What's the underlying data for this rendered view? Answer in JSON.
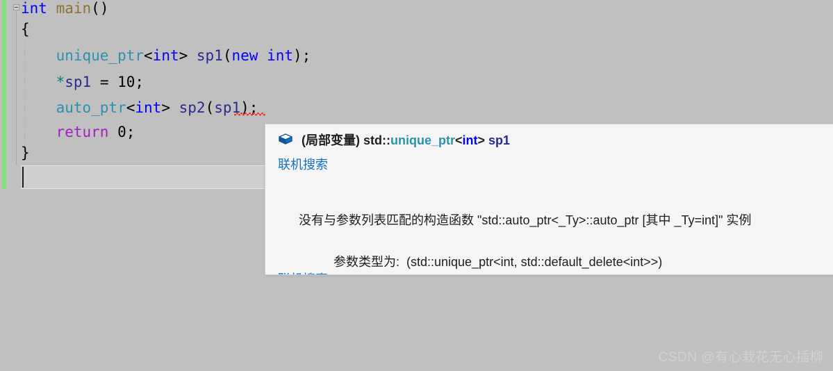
{
  "editor": {
    "lines": [
      {
        "id": "line1",
        "tokens": [
          {
            "text": "int",
            "kind": "kw"
          },
          {
            "text": " ",
            "kind": "plain"
          },
          {
            "text": "main",
            "kind": "fn"
          },
          {
            "text": "()",
            "kind": "plain"
          }
        ],
        "plain": "int main()"
      },
      {
        "id": "line2",
        "tokens": [
          {
            "text": "{",
            "kind": "plain"
          }
        ],
        "plain": "{"
      },
      {
        "id": "line3",
        "tokens": [
          {
            "text": "    ",
            "kind": "plain"
          },
          {
            "text": "unique_ptr",
            "kind": "type"
          },
          {
            "text": "<",
            "kind": "plain"
          },
          {
            "text": "int",
            "kind": "kw"
          },
          {
            "text": "> ",
            "kind": "plain"
          },
          {
            "text": "sp1",
            "kind": "ident"
          },
          {
            "text": "(",
            "kind": "plain"
          },
          {
            "text": "new",
            "kind": "kw"
          },
          {
            "text": " ",
            "kind": "plain"
          },
          {
            "text": "int",
            "kind": "kw"
          },
          {
            "text": ");",
            "kind": "plain"
          }
        ],
        "plain": "    unique_ptr<int> sp1(new int);"
      },
      {
        "id": "line4",
        "tokens": [
          {
            "text": "    ",
            "kind": "plain"
          },
          {
            "text": "*",
            "kind": "op"
          },
          {
            "text": "sp1",
            "kind": "ident"
          },
          {
            "text": " = ",
            "kind": "plain"
          },
          {
            "text": "10",
            "kind": "num"
          },
          {
            "text": ";",
            "kind": "plain"
          }
        ],
        "plain": "    *sp1 = 10;"
      },
      {
        "id": "line5",
        "tokens": [
          {
            "text": "    ",
            "kind": "plain"
          },
          {
            "text": "auto_ptr",
            "kind": "type"
          },
          {
            "text": "<",
            "kind": "plain"
          },
          {
            "text": "int",
            "kind": "kw"
          },
          {
            "text": "> ",
            "kind": "plain"
          },
          {
            "text": "sp2",
            "kind": "ident"
          },
          {
            "text": "(",
            "kind": "plain"
          },
          {
            "text": "sp1",
            "kind": "ident"
          },
          {
            "text": ");",
            "kind": "plain"
          }
        ],
        "plain": "    auto_ptr<int> sp2(sp1);"
      },
      {
        "id": "line6",
        "tokens": [
          {
            "text": "    ",
            "kind": "plain"
          },
          {
            "text": "return",
            "kind": "ctrl"
          },
          {
            "text": " ",
            "kind": "plain"
          },
          {
            "text": "0",
            "kind": "num"
          },
          {
            "text": ";",
            "kind": "plain"
          }
        ],
        "plain": "    return 0;"
      },
      {
        "id": "line7",
        "tokens": [
          {
            "text": "}",
            "kind": "plain"
          }
        ],
        "plain": "}"
      }
    ],
    "error_squiggle_token": "sp1"
  },
  "tooltip": {
    "icon": "local-variable-box-icon",
    "signature_plain": "(局部变量) std::unique_ptr<int> sp1",
    "signature_tokens": [
      {
        "text": "(局部变量) ",
        "kind": "sig-label"
      },
      {
        "text": "std::",
        "kind": "sig-std"
      },
      {
        "text": "unique_ptr",
        "kind": "sig-type"
      },
      {
        "text": "<",
        "kind": "sig-angle"
      },
      {
        "text": "int",
        "kind": "sig-int"
      },
      {
        "text": "> ",
        "kind": "sig-angle"
      },
      {
        "text": "sp1",
        "kind": "sig-name"
      }
    ],
    "link_top": "联机搜索",
    "link_bottom": "联机搜索",
    "error_line_1": "没有与参数列表匹配的构造函数 \"std::auto_ptr<_Ty>::auto_ptr [其中 _Ty=int]\" 实例",
    "error_line_2": "参数类型为:  (std::unique_ptr<int, std::default_delete<int>>)"
  },
  "watermark": {
    "text": "CSDN @有心栽花无心插柳"
  },
  "colors": {
    "background": "#c0c0c0",
    "tooltip_bg": "#f5f5f5",
    "tooltip_border": "#cdd0dd",
    "link": "#1570bd",
    "keyword": "#0000ff",
    "type": "#2b91af",
    "identifier": "#2a2a8c",
    "control": "#a020c0",
    "function": "#8f7230",
    "operator": "#0c7a7a",
    "change_bar": "#7ee07e",
    "squiggle": "#e33333"
  }
}
